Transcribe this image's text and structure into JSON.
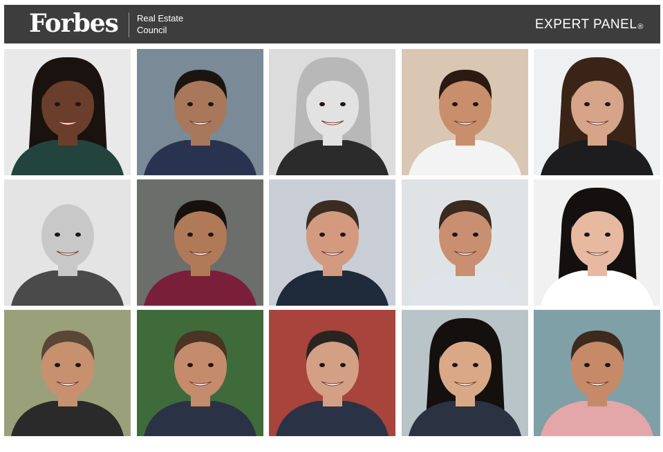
{
  "header": {
    "logo": "Forbes",
    "council_line1": "Real Estate",
    "council_line2": "Council",
    "panel_label": "EXPERT PANEL",
    "panel_mark": "®",
    "background_color": "#3d3d3d",
    "text_color": "#ffffff"
  },
  "grid": {
    "rows": 3,
    "columns": 5,
    "headshots": [
      {
        "bg": "#e9e9ea",
        "skin": "#6a3e2a",
        "hair": "#1a120e",
        "shirt": "#22443c",
        "style": "long"
      },
      {
        "bg": "#7a8a96",
        "skin": "#a9785a",
        "hair": "#1b1512",
        "shirt": "#28344f",
        "style": "short"
      },
      {
        "bg": "#dcdcdc",
        "skin": "#e2e2e2",
        "hair": "#b8b8b8",
        "shirt": "#2b2b2b",
        "style": "long"
      },
      {
        "bg": "#d9c7b3",
        "skin": "#c98e6c",
        "hair": "#2a1a12",
        "shirt": "#f3f3f3",
        "style": "short"
      },
      {
        "bg": "#eef0f2",
        "skin": "#d6a489",
        "hair": "#3a2418",
        "shirt": "#1d1d1f",
        "style": "long"
      },
      {
        "bg": "#e4e4e4",
        "skin": "#c8c8c8",
        "hair": "#bdbdbd",
        "shirt": "#4a4a4a",
        "style": "bald"
      },
      {
        "bg": "#6b6e6a",
        "skin": "#b07a58",
        "hair": "#17110d",
        "shirt": "#7a1f3a",
        "style": "short"
      },
      {
        "bg": "#c9ced6",
        "skin": "#d39a7f",
        "hair": "#3b2c22",
        "shirt": "#1f2a3a",
        "style": "short"
      },
      {
        "bg": "#dfe3e6",
        "skin": "#c88f71",
        "hair": "#3a2a20",
        "shirt": "#dfe4ea",
        "style": "short"
      },
      {
        "bg": "#f1f1f1",
        "skin": "#e6b9a0",
        "hair": "#141010",
        "shirt": "#ffffff",
        "style": "long"
      },
      {
        "bg": "#9aa07a",
        "skin": "#c7916f",
        "hair": "#5a4634",
        "shirt": "#2a2a2a",
        "style": "short"
      },
      {
        "bg": "#3f6b3a",
        "skin": "#c58b6d",
        "hair": "#4a3424",
        "shirt": "#2a3346",
        "style": "short"
      },
      {
        "bg": "#a8443c",
        "skin": "#d3a086",
        "hair": "#2a2420",
        "shirt": "#2a3346",
        "style": "short"
      },
      {
        "bg": "#b9c4c9",
        "skin": "#d9a987",
        "hair": "#14100e",
        "shirt": "#2b3242",
        "style": "long"
      },
      {
        "bg": "#7fa0a6",
        "skin": "#c68a68",
        "hair": "#3c2a1e",
        "shirt": "#e3a6a9",
        "style": "short"
      }
    ]
  }
}
